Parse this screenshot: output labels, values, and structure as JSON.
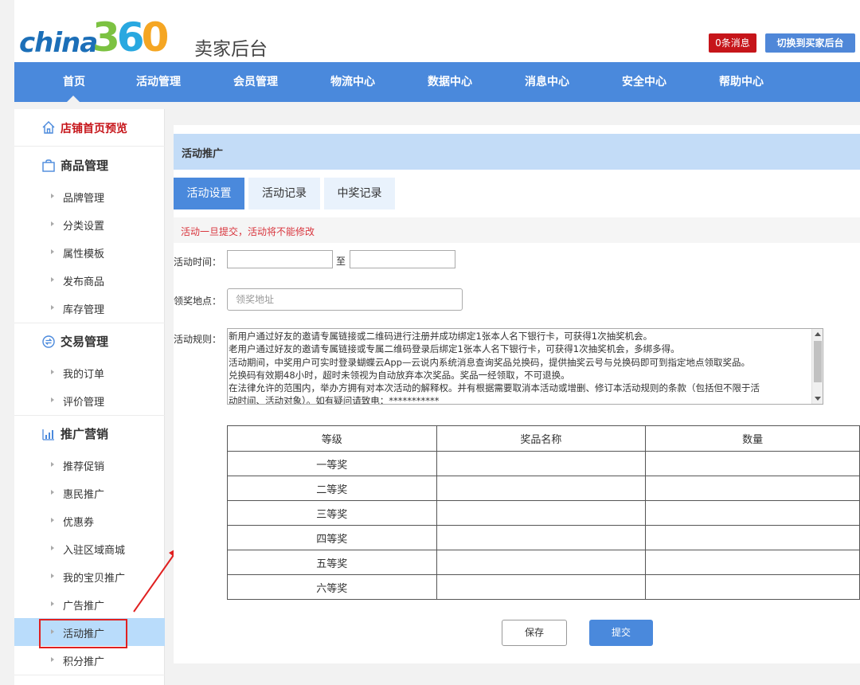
{
  "header": {
    "logo_text": "china360",
    "title": "卖家后台",
    "messages_button": "0条消息",
    "switch_button": "切换到买家后台"
  },
  "nav": [
    "首页",
    "活动管理",
    "会员管理",
    "物流中心",
    "数据中心",
    "消息中心",
    "安全中心",
    "帮助中心"
  ],
  "sidebar": {
    "store_preview": "店铺首页预览",
    "sections": [
      {
        "label": "商品管理",
        "icon": "bag-icon",
        "items": [
          "品牌管理",
          "分类设置",
          "属性模板",
          "发布商品",
          "库存管理"
        ]
      },
      {
        "label": "交易管理",
        "icon": "exchange-icon",
        "items": [
          "我的订单",
          "评价管理"
        ]
      },
      {
        "label": "推广营销",
        "icon": "chart-icon",
        "items": [
          "推荐促销",
          "惠民推广",
          "优惠券",
          "入驻区域商城",
          "我的宝贝推广",
          "广告推广",
          "活动推广",
          "积分推广"
        ]
      }
    ],
    "active_item": "活动推广"
  },
  "main": {
    "title": "活动推广",
    "tabs": [
      "活动设置",
      "活动记录",
      "中奖记录"
    ],
    "active_tab": "活动设置",
    "notice": "活动一旦提交，活动将不能修改",
    "time_label": "活动时间：",
    "time_separator": "至",
    "start_date": "",
    "end_date": "",
    "location_label": "领奖地点：",
    "location_placeholder": "领奖地址",
    "rules_label": "活动规则：",
    "rules_lines": [
      "新用户通过好友的邀请专属链接或二维码进行注册并成功绑定1张本人名下银行卡，可获得1次抽奖机会。",
      "老用户通过好友的邀请专属链接或专属二维码登录后绑定1张本人名下银行卡，可获得1次抽奖机会，多绑多得。",
      "活动期间，中奖用户可实时登录蝴蝶云App—云说内系统消息查询奖品兑换码，提供抽奖云号与兑换码即可到指定地点领取奖品。",
      "兑换码有效期48小时，超时未领视为自动放弃本次奖品。奖品一经领取，不可退换。",
      "在法律允许的范围内，举办方拥有对本次活动的解释权。并有根据需要取消本活动或增删、修订本活动规则的条款（包括但不限于活",
      "动时间、活动对象）。如有疑问请致电：***********"
    ],
    "table": {
      "headers": [
        "等级",
        "奖品名称",
        "数量"
      ],
      "rows": [
        "一等奖",
        "二等奖",
        "三等奖",
        "四等奖",
        "五等奖",
        "六等奖"
      ]
    },
    "save_button": "保存",
    "submit_button": "提交"
  },
  "colors": {
    "nav_blue": "#4a89dc",
    "title_bar": "#c3dcf7",
    "brand_red": "#c6151a",
    "notice_red": "#d9363e",
    "sidebar_active": "#b9dcfb",
    "annotation_red": "#e02020"
  }
}
